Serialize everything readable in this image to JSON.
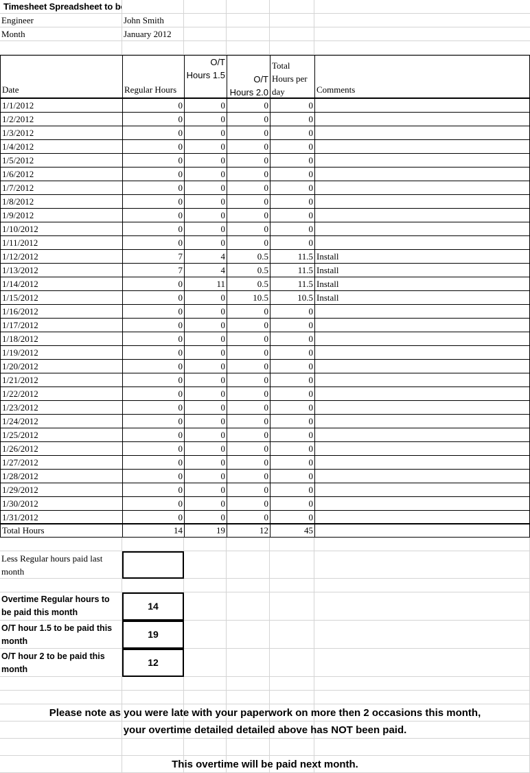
{
  "document": {
    "title": "Timesheet Spreadsheet to be sent to Engineer"
  },
  "info": {
    "engineer_label": "Engineer",
    "engineer_value": "John Smith",
    "month_label": "Month",
    "month_value": "January 2012"
  },
  "table": {
    "headers": {
      "date": "Date",
      "regular_hours": "Regular Hours",
      "ot_hours_15": "O/T Hours 1.5",
      "ot_hours_20": "O/T Hours 2.0",
      "total_hours_per_day": "Total Hours per day",
      "comments": "Comments"
    },
    "rows": [
      {
        "date": "1/1/2012",
        "regular": "0",
        "ot15": "0",
        "ot20": "0",
        "total": "0",
        "comment": ""
      },
      {
        "date": "1/2/2012",
        "regular": "0",
        "ot15": "0",
        "ot20": "0",
        "total": "0",
        "comment": ""
      },
      {
        "date": "1/3/2012",
        "regular": "0",
        "ot15": "0",
        "ot20": "0",
        "total": "0",
        "comment": ""
      },
      {
        "date": "1/4/2012",
        "regular": "0",
        "ot15": "0",
        "ot20": "0",
        "total": "0",
        "comment": ""
      },
      {
        "date": "1/5/2012",
        "regular": "0",
        "ot15": "0",
        "ot20": "0",
        "total": "0",
        "comment": ""
      },
      {
        "date": "1/6/2012",
        "regular": "0",
        "ot15": "0",
        "ot20": "0",
        "total": "0",
        "comment": ""
      },
      {
        "date": "1/7/2012",
        "regular": "0",
        "ot15": "0",
        "ot20": "0",
        "total": "0",
        "comment": ""
      },
      {
        "date": "1/8/2012",
        "regular": "0",
        "ot15": "0",
        "ot20": "0",
        "total": "0",
        "comment": ""
      },
      {
        "date": "1/9/2012",
        "regular": "0",
        "ot15": "0",
        "ot20": "0",
        "total": "0",
        "comment": ""
      },
      {
        "date": "1/10/2012",
        "regular": "0",
        "ot15": "0",
        "ot20": "0",
        "total": "0",
        "comment": ""
      },
      {
        "date": "1/11/2012",
        "regular": "0",
        "ot15": "0",
        "ot20": "0",
        "total": "0",
        "comment": ""
      },
      {
        "date": "1/12/2012",
        "regular": "7",
        "ot15": "4",
        "ot20": "0.5",
        "total": "11.5",
        "comment": "Install"
      },
      {
        "date": "1/13/2012",
        "regular": "7",
        "ot15": "4",
        "ot20": "0.5",
        "total": "11.5",
        "comment": "Install"
      },
      {
        "date": "1/14/2012",
        "regular": "0",
        "ot15": "11",
        "ot20": "0.5",
        "total": "11.5",
        "comment": "Install"
      },
      {
        "date": "1/15/2012",
        "regular": "0",
        "ot15": "0",
        "ot20": "10.5",
        "total": "10.5",
        "comment": "Install"
      },
      {
        "date": "1/16/2012",
        "regular": "0",
        "ot15": "0",
        "ot20": "0",
        "total": "0",
        "comment": ""
      },
      {
        "date": "1/17/2012",
        "regular": "0",
        "ot15": "0",
        "ot20": "0",
        "total": "0",
        "comment": ""
      },
      {
        "date": "1/18/2012",
        "regular": "0",
        "ot15": "0",
        "ot20": "0",
        "total": "0",
        "comment": ""
      },
      {
        "date": "1/19/2012",
        "regular": "0",
        "ot15": "0",
        "ot20": "0",
        "total": "0",
        "comment": ""
      },
      {
        "date": "1/20/2012",
        "regular": "0",
        "ot15": "0",
        "ot20": "0",
        "total": "0",
        "comment": ""
      },
      {
        "date": "1/21/2012",
        "regular": "0",
        "ot15": "0",
        "ot20": "0",
        "total": "0",
        "comment": ""
      },
      {
        "date": "1/22/2012",
        "regular": "0",
        "ot15": "0",
        "ot20": "0",
        "total": "0",
        "comment": ""
      },
      {
        "date": "1/23/2012",
        "regular": "0",
        "ot15": "0",
        "ot20": "0",
        "total": "0",
        "comment": ""
      },
      {
        "date": "1/24/2012",
        "regular": "0",
        "ot15": "0",
        "ot20": "0",
        "total": "0",
        "comment": ""
      },
      {
        "date": "1/25/2012",
        "regular": "0",
        "ot15": "0",
        "ot20": "0",
        "total": "0",
        "comment": ""
      },
      {
        "date": "1/26/2012",
        "regular": "0",
        "ot15": "0",
        "ot20": "0",
        "total": "0",
        "comment": ""
      },
      {
        "date": "1/27/2012",
        "regular": "0",
        "ot15": "0",
        "ot20": "0",
        "total": "0",
        "comment": ""
      },
      {
        "date": "1/28/2012",
        "regular": "0",
        "ot15": "0",
        "ot20": "0",
        "total": "0",
        "comment": ""
      },
      {
        "date": "1/29/2012",
        "regular": "0",
        "ot15": "0",
        "ot20": "0",
        "total": "0",
        "comment": ""
      },
      {
        "date": "1/30/2012",
        "regular": "0",
        "ot15": "0",
        "ot20": "0",
        "total": "0",
        "comment": ""
      },
      {
        "date": "1/31/2012",
        "regular": "0",
        "ot15": "0",
        "ot20": "0",
        "total": "0",
        "comment": ""
      }
    ],
    "totals": {
      "label": "Total Hours",
      "regular": "14",
      "ot15": "19",
      "ot20": "12",
      "total": "45",
      "comment": ""
    }
  },
  "summary": {
    "less_regular_label": "Less Regular hours paid last month",
    "less_regular_value": "",
    "overtime_regular_label": "Overtime Regular hours to be paid this month",
    "overtime_regular_value": "14",
    "ot15_label": "O/T hour 1.5 to be paid this month",
    "ot15_value": "19",
    "ot2_label": "O/T hour 2 to be paid this month",
    "ot2_value": "12"
  },
  "notes": {
    "line1": "Please note as you were late with your paperwork on more then 2 occasions this month,",
    "line2": "your overtime detailed detailed above has NOT been paid.",
    "line3": "This overtime will be paid next month."
  }
}
